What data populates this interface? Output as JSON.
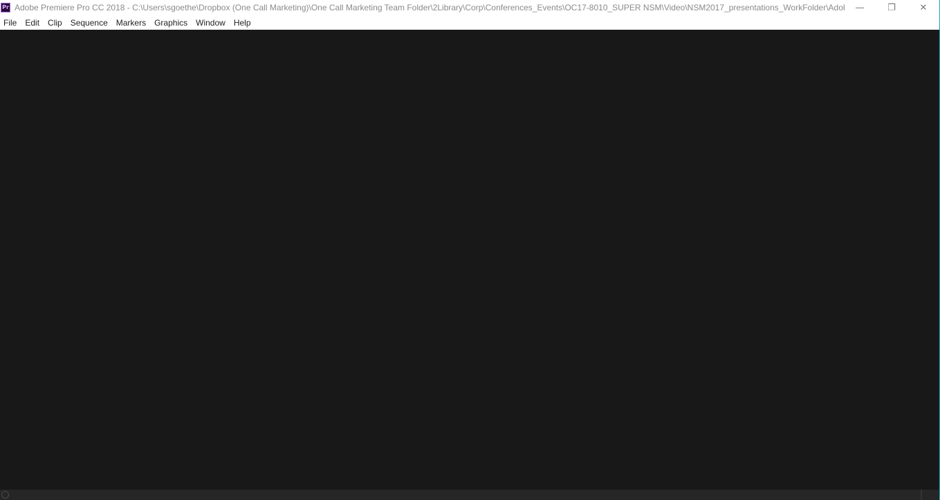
{
  "window": {
    "app_icon_label": "Pr",
    "title": "Adobe Premiere Pro CC 2018 - C:\\Users\\sgoethe\\Dropbox (One Call Marketing)\\One Call Marketing Team Folder\\2Library\\Corp\\Conferences_Events\\OC17-8010_SUPER NSM\\Video\\NSM2017_presentations_WorkFolder\\Adobe ...",
    "controls": {
      "minimize": "—",
      "restore": "❐",
      "close": "✕"
    }
  },
  "menubar": {
    "items": [
      "File",
      "Edit",
      "Clip",
      "Sequence",
      "Markers",
      "Graphics",
      "Window",
      "Help"
    ]
  },
  "colors": {
    "workspace_bg": "#181818",
    "statusbar_bg": "#262626",
    "window_accent": "#1aa9b7"
  }
}
